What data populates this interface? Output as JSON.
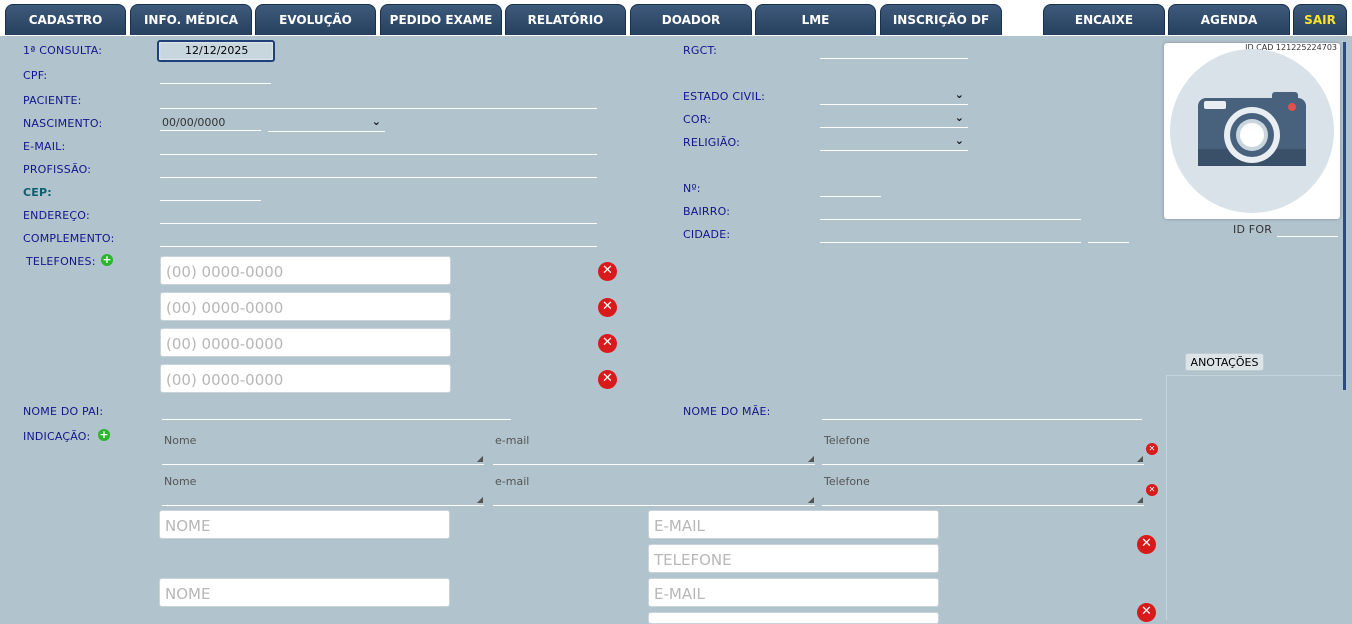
{
  "tabs": [
    {
      "label": "CADASTRO"
    },
    {
      "label": "INFO. MÉDICA"
    },
    {
      "label": "EVOLUÇÃO"
    },
    {
      "label": "PEDIDO EXAME"
    },
    {
      "label": "RELATÓRIO"
    },
    {
      "label": "DOADOR"
    },
    {
      "label": "LME"
    },
    {
      "label": "INSCRIÇÃO DF"
    },
    {
      "label": "ENCAIXE"
    },
    {
      "label": "AGENDA"
    },
    {
      "label": "SAIR"
    }
  ],
  "form": {
    "primeira_consulta_label": "1ª CONSULTA:",
    "primeira_consulta_value": "12/12/2025",
    "cpf_label": "CPF:",
    "paciente_label": "PACIENTE:",
    "nascimento_label": "NASCIMENTO:",
    "nascimento_value": "00/00/0000",
    "email_label": "E-MAIL:",
    "profissao_label": "PROFISSÃO:",
    "cep_label": "CEP:",
    "endereco_label": "ENDEREÇO:",
    "complemento_label": "COMPLEMENTO:",
    "telefones_label": "TELEFONES:",
    "rgct_label": "RGCT:",
    "estado_civil_label": "ESTADO CIVIL:",
    "cor_label": "COR:",
    "religiao_label": "RELIGIÃO:",
    "numero_label": "Nº:",
    "bairro_label": "BAIRRO:",
    "cidade_label": "CIDADE:",
    "nome_pai_label": "NOME DO PAI:",
    "nome_mae_label": "NOME DO MÃE:",
    "indicacao_label": "INDICAÇÃO:"
  },
  "phones": {
    "placeholder": "(00) 0000-0000"
  },
  "indicacao": {
    "nome_ph": "Nome",
    "email_ph": "e-mail",
    "telefone_ph": "Telefone"
  },
  "extra": {
    "nome_ph": "NOME",
    "email_ph": "E-MAIL",
    "telefone_ph": "TELEFONE"
  },
  "sidebar": {
    "id_cad": "ID CAD 121225224703",
    "id_for_label": "ID FOR",
    "anotacoes_label": "ANOTAÇÕES"
  },
  "icons": {
    "remove": "close-circle-icon",
    "add": "plus-circle-icon",
    "photo": "camera-icon"
  },
  "colors": {
    "tab_bg": "#2f4b6c",
    "sair_text": "#ffe32a",
    "page_bg": "#b1c3cc",
    "label_text": "#10178a",
    "remove_red": "#d81a1a",
    "add_green": "#2bb52b"
  }
}
